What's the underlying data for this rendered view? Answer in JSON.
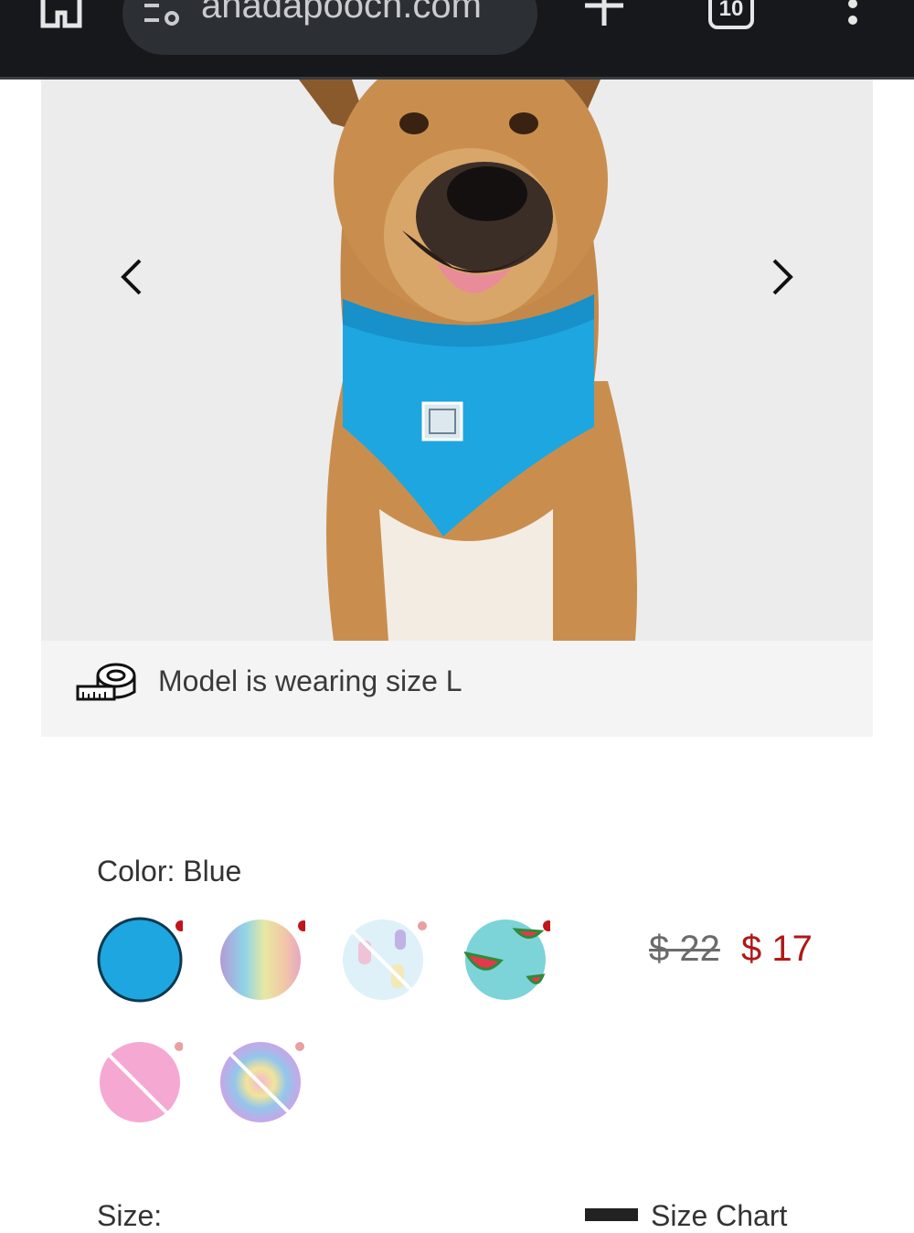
{
  "browser": {
    "url": "anadapooch.com",
    "tab_count": "10"
  },
  "gallery": {
    "prev_label": "Previous image",
    "next_label": "Next image"
  },
  "size_note": {
    "text": "Model is wearing size L"
  },
  "product": {
    "color_label": "Color: Blue",
    "swatches": [
      {
        "name": "Blue",
        "selected": true,
        "available": true
      },
      {
        "name": "Iridescent",
        "selected": false,
        "available": true
      },
      {
        "name": "Popsicle print",
        "selected": false,
        "available": false
      },
      {
        "name": "Watermelon print",
        "selected": false,
        "available": true
      },
      {
        "name": "Pink",
        "selected": false,
        "available": false
      },
      {
        "name": "Tie-dye",
        "selected": false,
        "available": false
      }
    ],
    "price_original": "$ 22",
    "price_sale": "$ 17",
    "size_label": "Size:",
    "size_chart_label": "Size Chart"
  },
  "colors": {
    "accent_blue": "#1ea6e0",
    "sale_red": "#b01818",
    "badge_red": "#c0151b"
  }
}
